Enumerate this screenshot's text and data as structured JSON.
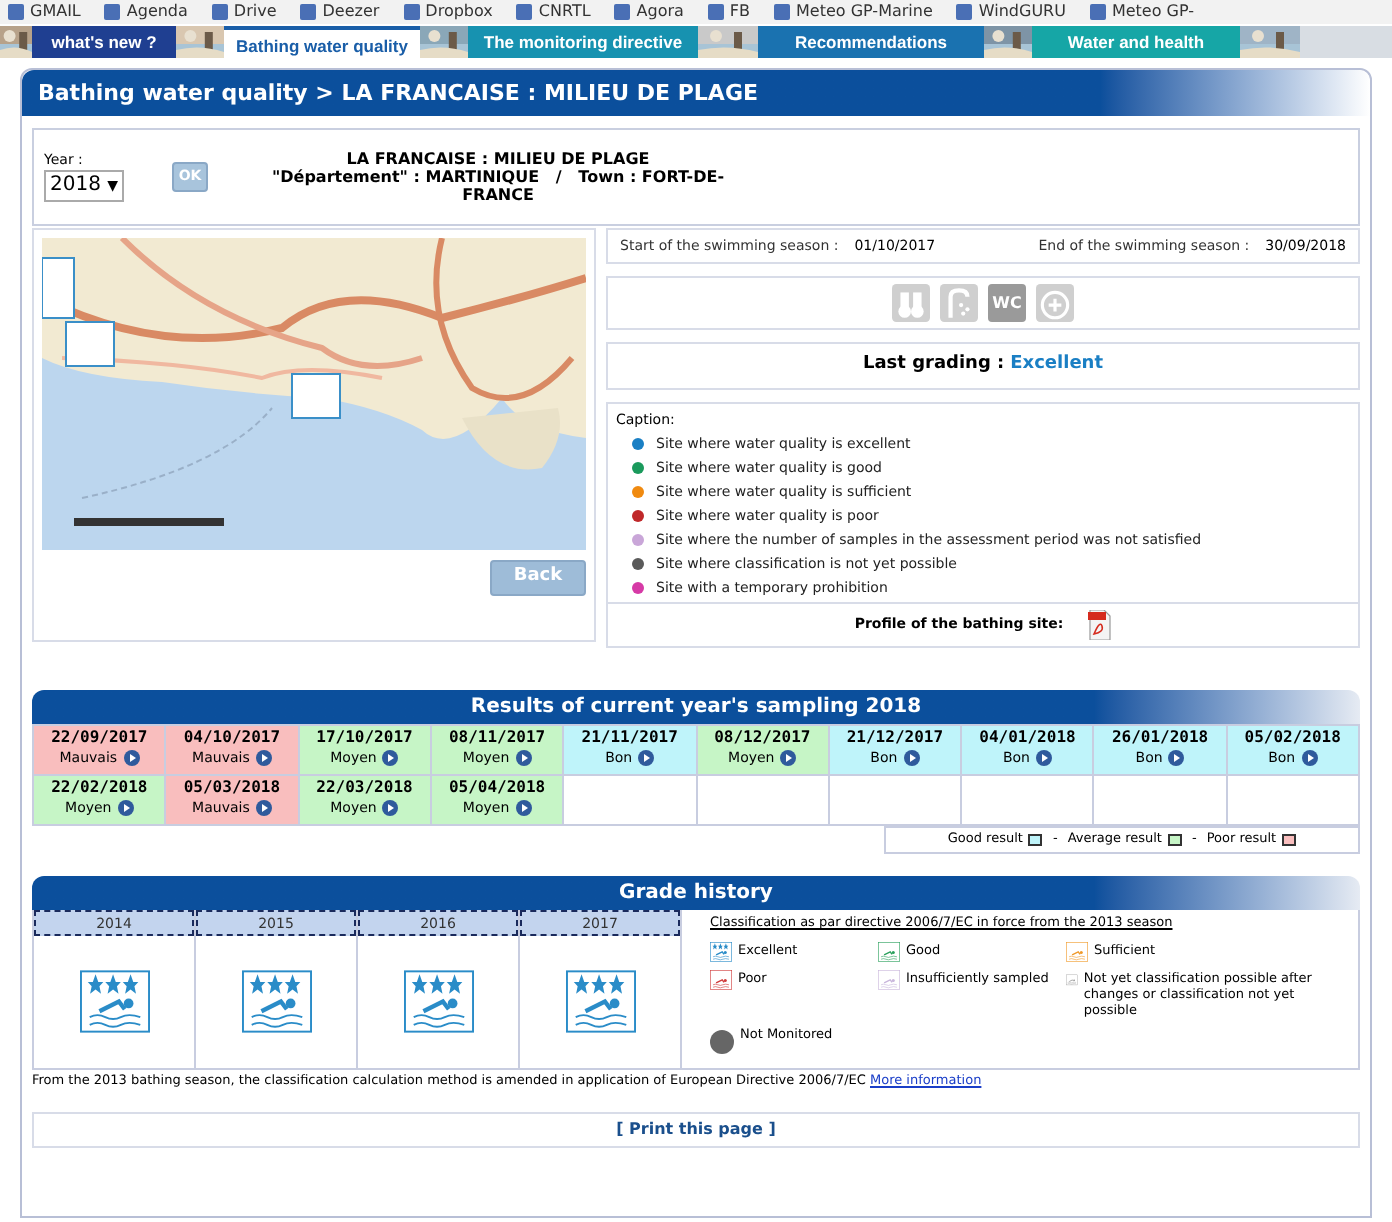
{
  "bookmarks": [
    "GMAIL",
    "Agenda",
    "Drive",
    "Deezer",
    "Dropbox",
    "CNRTL",
    "Agora",
    "FB",
    "Meteo GP-Marine",
    "WindGURU",
    "Meteo GP-"
  ],
  "nav_tabs": [
    {
      "label": "what's new ?",
      "selected": false,
      "color": "#1f3f91"
    },
    {
      "label": "Bathing water quality",
      "selected": true,
      "color": "#ffffff"
    },
    {
      "label": "The monitoring directive",
      "selected": false,
      "color": "#1792b0"
    },
    {
      "label": "Recommendations",
      "selected": false,
      "color": "#1a72b0"
    },
    {
      "label": "Water and health",
      "selected": false,
      "color": "#16a6a6"
    }
  ],
  "page_title": "Bathing water quality > LA FRANCAISE : MILIEU DE PLAGE",
  "year_select": {
    "label": "Year :",
    "value": "2018",
    "arrow": "▼",
    "button": "OK"
  },
  "site": {
    "name": "LA FRANCAISE : MILIEU DE PLAGE",
    "location": "\"Département\" : MARTINIQUE   /   Town : FORT-DE-FRANCE"
  },
  "back_button": "Back",
  "season": {
    "start_label": "Start of the swimming season :",
    "start": "01/10/2017",
    "end_label": "End of the swimming season :",
    "end": "30/09/2018"
  },
  "facilities": [
    {
      "kind": "binoculars"
    },
    {
      "kind": "shower"
    },
    {
      "kind": "wc",
      "label": "WC"
    },
    {
      "kind": "first_aid"
    }
  ],
  "last_grading": {
    "label": "Last grading :",
    "value": "Excellent"
  },
  "caption": {
    "title": "Caption:",
    "items": [
      {
        "text": "Site where water quality is excellent",
        "color": "#1a7fc4"
      },
      {
        "text": "Site where water quality is good",
        "color": "#1a9a5c"
      },
      {
        "text": "Site where water quality is sufficient",
        "color": "#f08a10"
      },
      {
        "text": "Site where water quality is poor",
        "color": "#c0282a"
      },
      {
        "text": "Site where the number of samples in the assessment period was not satisfied",
        "color": "#c9a6d8"
      },
      {
        "text": "Site where classification is not yet possible",
        "color": "#5a5a5a"
      },
      {
        "text": "Site with a temporary prohibition",
        "color": "#d63aa6"
      }
    ]
  },
  "profile_label": "Profile of the bathing site:",
  "sampling": {
    "title": "Results of current year's sampling 2018",
    "samples": [
      {
        "date": "22/09/2017",
        "result": "Mauvais",
        "color": "#f9bebe"
      },
      {
        "date": "04/10/2017",
        "result": "Mauvais",
        "color": "#f9bebe"
      },
      {
        "date": "17/10/2017",
        "result": "Moyen",
        "color": "#c6f5c6"
      },
      {
        "date": "08/11/2017",
        "result": "Moyen",
        "color": "#c6f5c6"
      },
      {
        "date": "21/11/2017",
        "result": "Bon",
        "color": "#bff4fa"
      },
      {
        "date": "08/12/2017",
        "result": "Moyen",
        "color": "#c6f5c6"
      },
      {
        "date": "21/12/2017",
        "result": "Bon",
        "color": "#bff4fa"
      },
      {
        "date": "04/01/2018",
        "result": "Bon",
        "color": "#bff4fa"
      },
      {
        "date": "26/01/2018",
        "result": "Bon",
        "color": "#bff4fa"
      },
      {
        "date": "05/02/2018",
        "result": "Bon",
        "color": "#bff4fa"
      },
      {
        "date": "22/02/2018",
        "result": "Moyen",
        "color": "#c6f5c6"
      },
      {
        "date": "05/03/2018",
        "result": "Mauvais",
        "color": "#f9bebe"
      },
      {
        "date": "22/03/2018",
        "result": "Moyen",
        "color": "#c6f5c6"
      },
      {
        "date": "05/04/2018",
        "result": "Moyen",
        "color": "#c6f5c6"
      }
    ],
    "legend": [
      {
        "kind": "swatch",
        "label": "Good result",
        "color": "#bff4fa"
      },
      {
        "kind": "separator",
        "text": "-"
      },
      {
        "kind": "swatch",
        "label": "Average result",
        "color": "#c6f5c6"
      },
      {
        "kind": "separator",
        "text": "-"
      },
      {
        "kind": "swatch",
        "label": "Poor result",
        "color": "#f9bebe"
      }
    ]
  },
  "grade_history": {
    "title": "Grade history",
    "years": [
      {
        "year": "2014",
        "kind": "excellent"
      },
      {
        "year": "2015",
        "kind": "excellent"
      },
      {
        "year": "2016",
        "kind": "excellent"
      },
      {
        "year": "2017",
        "kind": "excellent"
      }
    ],
    "classification_title": "Classification as par directive 2006/7/EC in force from the 2013 season",
    "legend": [
      {
        "label": "Excellent",
        "kind": "excellent"
      },
      {
        "label": "Good",
        "kind": "good"
      },
      {
        "label": "Sufficient",
        "kind": "sufficient"
      },
      {
        "label": "Poor",
        "kind": "poor"
      },
      {
        "label": "Insufficiently sampled",
        "kind": "insufficient"
      },
      {
        "label": "Not yet classification possible after changes or classification not yet possible",
        "kind": "not_yet"
      },
      {
        "label": "Not Monitored",
        "kind": "not_monitored"
      }
    ],
    "note": "From the 2013 bathing season, the classification calculation method is amended in application of European Directive 2006/7/EC",
    "note_link": "More information"
  },
  "print_link": "[ Print this page ]"
}
